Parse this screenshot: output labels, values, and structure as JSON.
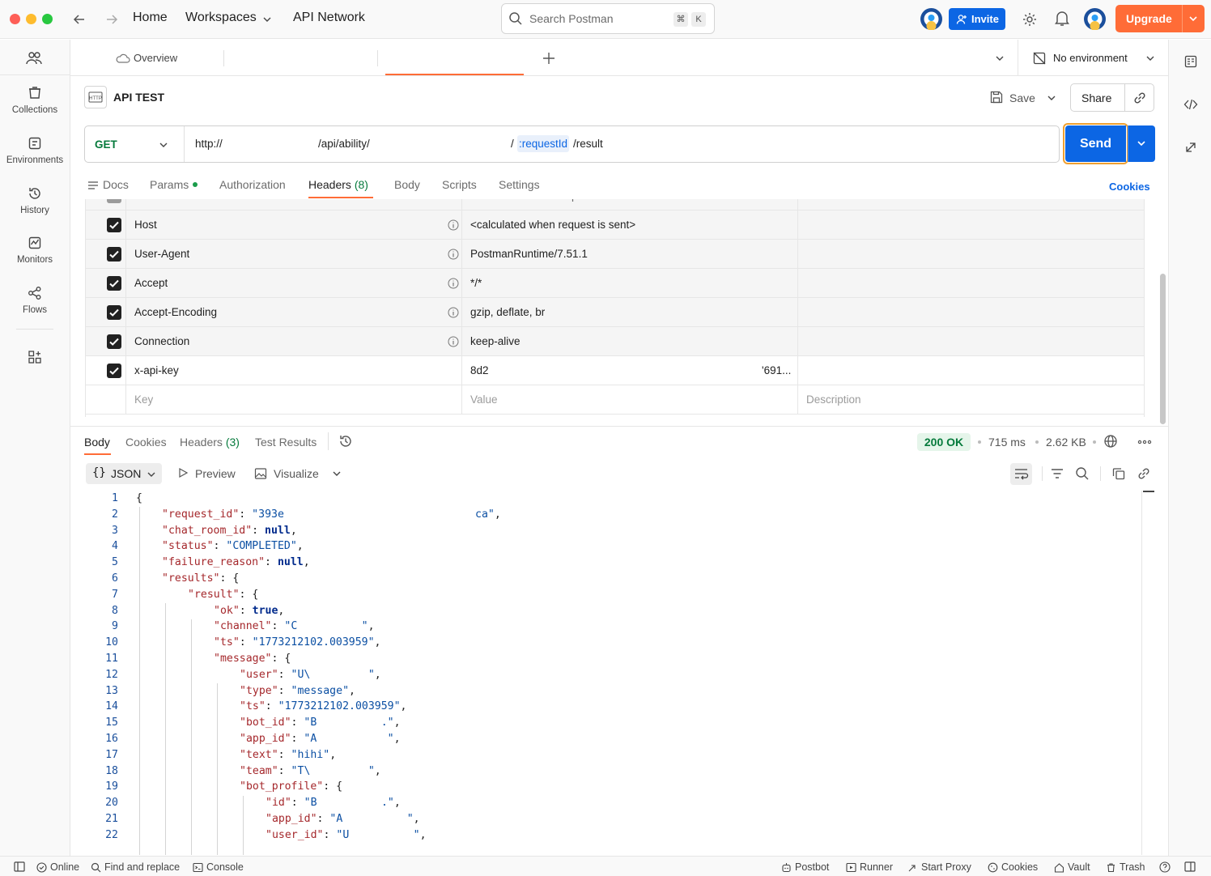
{
  "titlebar": {
    "nav": {
      "home": "Home",
      "workspaces": "Workspaces",
      "api_network": "API Network"
    },
    "search_placeholder": "Search Postman",
    "shortcut": [
      "⌘",
      "K"
    ],
    "invite_label": "Invite",
    "upgrade_label": "Upgrade"
  },
  "sidebar": {
    "items": [
      {
        "label": "Collections"
      },
      {
        "label": "Environments"
      },
      {
        "label": "History"
      },
      {
        "label": "Monitors"
      },
      {
        "label": "Flows"
      }
    ]
  },
  "tabs": {
    "overview_label": "Overview",
    "environment_label": "No environment"
  },
  "request": {
    "name": "API TEST",
    "save_label": "Save",
    "share_label": "Share",
    "method": "GET",
    "url_prefix": "http://",
    "url_path": "/api/ability/",
    "url_sep": "/",
    "url_param": ":requestId",
    "url_suffix": "/result",
    "send_label": "Send",
    "cookies_link": "Cookies",
    "tabs": [
      {
        "label": "Docs"
      },
      {
        "label": "Params"
      },
      {
        "label": "Authorization"
      },
      {
        "label": "Headers",
        "count": "(8)"
      },
      {
        "label": "Body"
      },
      {
        "label": "Scripts"
      },
      {
        "label": "Settings"
      }
    ],
    "headers": {
      "partial_row": {
        "key": "Postman-Token",
        "value": "<calculated when request is sent>"
      },
      "rows": [
        {
          "key": "Host",
          "value": "<calculated when request is sent>"
        },
        {
          "key": "User-Agent",
          "value": "PostmanRuntime/7.51.1"
        },
        {
          "key": "Accept",
          "value": "*/*"
        },
        {
          "key": "Accept-Encoding",
          "value": "gzip, deflate, br"
        },
        {
          "key": "Connection",
          "value": "keep-alive"
        },
        {
          "key": "x-api-key",
          "value": "8d2",
          "value_tail": "'691..."
        }
      ],
      "placeholder": {
        "key": "Key",
        "value": "Value",
        "description": "Description"
      }
    }
  },
  "response": {
    "tabs": [
      {
        "label": "Body"
      },
      {
        "label": "Cookies"
      },
      {
        "label": "Headers",
        "count": "(3)"
      },
      {
        "label": "Test Results"
      }
    ],
    "status": "200 OK",
    "time": "715 ms",
    "size": "2.62 KB",
    "format_label": "JSON",
    "preview_label": "Preview",
    "visualize_label": "Visualize",
    "body_lines": [
      "1",
      "2",
      "3",
      "4",
      "5",
      "6",
      "7",
      "8",
      "9",
      "10",
      "11",
      "12",
      "13",
      "14",
      "15",
      "16",
      "17",
      "18",
      "19",
      "20",
      "21",
      "22"
    ],
    "json": {
      "request_id": [
        "393e",
        "ca"
      ],
      "chat_room_id": "null",
      "status": "COMPLETED",
      "failure_reason": "null",
      "ok": "true",
      "channel": "C",
      "ts": "1773212102.003959",
      "user": "U\\",
      "type": "message",
      "bot_id": "B          .",
      "app_id": "A",
      "text": "hihi",
      "team": "T\\",
      "bp_id": "B          .",
      "bp_app_id": "A",
      "bp_user_id": "U"
    }
  },
  "statusbar": {
    "online": "Online",
    "find_replace": "Find and replace",
    "console": "Console",
    "postbot": "Postbot",
    "runner": "Runner",
    "start_proxy": "Start Proxy",
    "cookies": "Cookies",
    "vault": "Vault",
    "trash": "Trash"
  },
  "colors": {
    "accent": "#0c66e4",
    "brand": "#ff6c37",
    "get_method": "#067a3c",
    "ok_status": "#067a3c"
  }
}
